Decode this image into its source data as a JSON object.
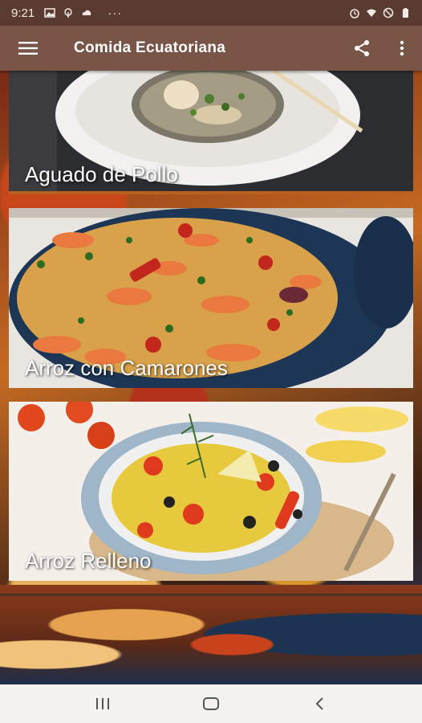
{
  "status_bar": {
    "time": "9:21",
    "more": "···",
    "left_icons": [
      "image-icon",
      "fingerprint-icon",
      "cloud-icon"
    ],
    "right_icons": [
      "alarm-icon",
      "wifi-icon",
      "do-not-disturb-icon",
      "battery-icon"
    ]
  },
  "app_bar": {
    "title": "Comida Ecuatoriana",
    "menu_icon": "hamburger-menu-icon",
    "share_icon": "share-icon",
    "overflow_icon": "more-vert-icon",
    "color": "#795548"
  },
  "recipes": [
    {
      "label": "Aguado de Pollo",
      "image": "chicken-soup-bowl"
    },
    {
      "label": "Arroz con Camarones",
      "image": "shrimp-rice-pot"
    },
    {
      "label": "Arroz Relleno",
      "image": "stuffed-rice-plate"
    }
  ],
  "nav_bar": {
    "buttons": [
      "recents-icon",
      "home-icon",
      "back-icon"
    ]
  }
}
